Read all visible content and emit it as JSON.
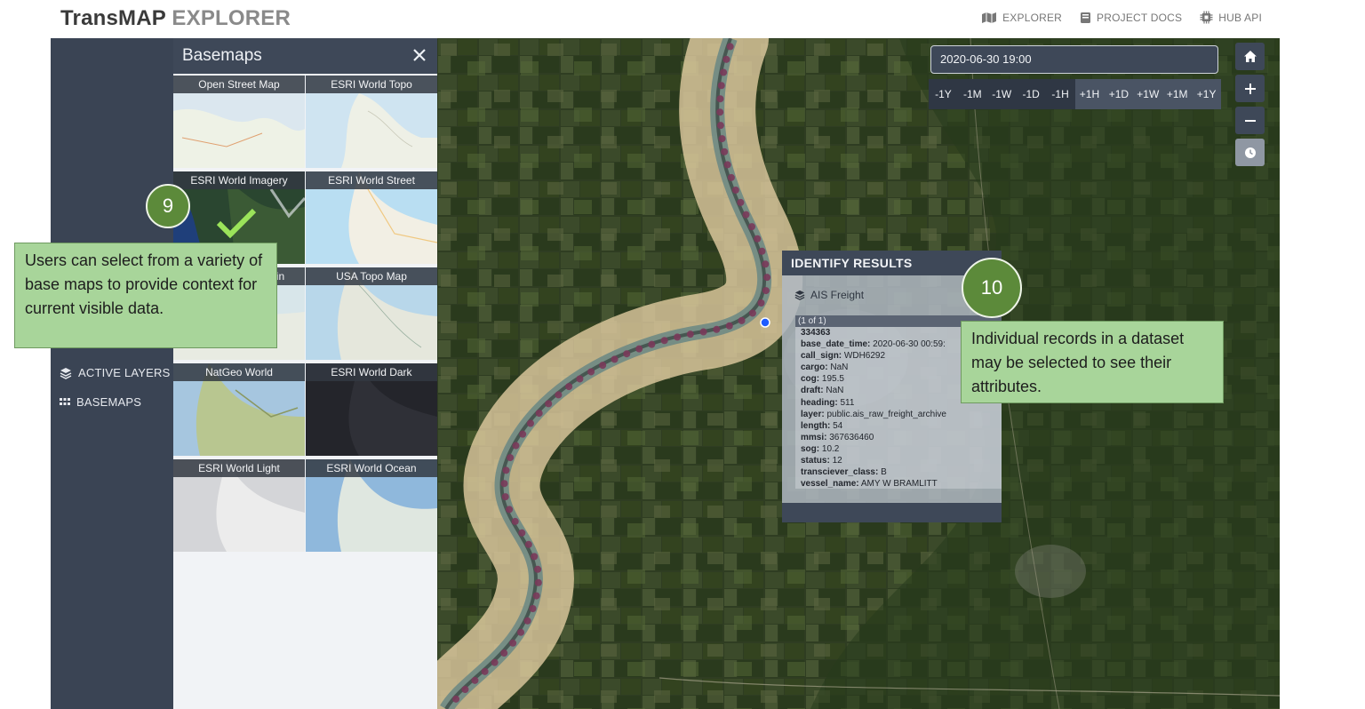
{
  "app": {
    "brand_main": "TransMAP",
    "brand_sub": "EXPLORER"
  },
  "topnav": [
    {
      "label": "EXPLORER",
      "icon": "map-icon"
    },
    {
      "label": "PROJECT DOCS",
      "icon": "book-icon"
    },
    {
      "label": "HUB API",
      "icon": "chip-icon"
    }
  ],
  "sidebar": {
    "items": [
      {
        "label": "ACTIVE LAYERS",
        "icon": "layers-icon"
      },
      {
        "label": "BASEMAPS",
        "icon": "grid-icon"
      }
    ]
  },
  "basemaps": {
    "title": "Basemaps",
    "selected": "ESRI World Imagery",
    "tiles": [
      {
        "label": "Open Street Map",
        "style": "osm"
      },
      {
        "label": "ESRI World Topo",
        "style": "topo"
      },
      {
        "label": "ESRI World Imagery",
        "style": "imagery"
      },
      {
        "label": "ESRI World Street",
        "style": "street"
      },
      {
        "label": "ESRI World Terrain",
        "style": "terrain"
      },
      {
        "label": "USA Topo Map",
        "style": "usatopo"
      },
      {
        "label": "NatGeo World",
        "style": "natgeo"
      },
      {
        "label": "ESRI World Dark",
        "style": "dark"
      },
      {
        "label": "ESRI World Light",
        "style": "light"
      },
      {
        "label": "ESRI World Ocean",
        "style": "ocean"
      }
    ]
  },
  "time": {
    "datetime": "2020-06-30 19:00",
    "steps_back": [
      "-1Y",
      "-1M",
      "-1W",
      "-1D",
      "-1H"
    ],
    "steps_fwd": [
      "+1H",
      "+1D",
      "+1W",
      "+1M",
      "+1Y"
    ]
  },
  "map_controls": [
    "home-icon",
    "zoom-in-icon",
    "zoom-out-icon",
    "clock-icon"
  ],
  "identify": {
    "title": "IDENTIFY RESULTS",
    "layer": "AIS Freight",
    "pager": "(1 of 1)",
    "record_id": "334363",
    "attributes": [
      {
        "key": "base_date_time:",
        "value": "2020-06-30 00:59:"
      },
      {
        "key": "call_sign:",
        "value": "WDH6292"
      },
      {
        "key": "cargo:",
        "value": "NaN"
      },
      {
        "key": "cog:",
        "value": "195.5"
      },
      {
        "key": "draft:",
        "value": "NaN"
      },
      {
        "key": "heading:",
        "value": "511"
      },
      {
        "key": "layer:",
        "value": "public.ais_raw_freight_archive"
      },
      {
        "key": "length:",
        "value": "54"
      },
      {
        "key": "mmsi:",
        "value": "367636460"
      },
      {
        "key": "sog:",
        "value": "10.2"
      },
      {
        "key": "status:",
        "value": "12"
      },
      {
        "key": "transciever_class:",
        "value": "B"
      },
      {
        "key": "vessel_name:",
        "value": "AMY W BRAMLITT"
      }
    ]
  },
  "callouts": {
    "badge_9": "9",
    "note_9": "Users can select from a variety of base maps to provide context for current visible data.",
    "badge_10": "10",
    "note_10": "Individual records in a dataset may be selected to see their attributes."
  },
  "colors": {
    "sidebar": "#3a4454",
    "panel_header": "#3e4858",
    "callout_green": "#a8d59a",
    "badge_green": "#5c8a3a",
    "checkmark": "#9be35a"
  }
}
